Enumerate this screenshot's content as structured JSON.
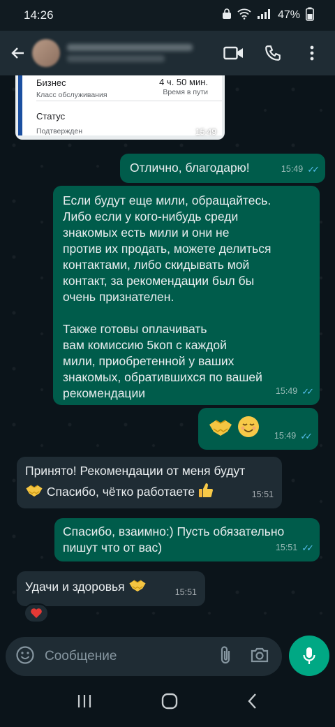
{
  "status_bar": {
    "time": "14:26",
    "battery": "47%"
  },
  "header": {
    "back_label": "←",
    "actions": [
      "video-call-icon",
      "phone-icon",
      "more-vert-icon"
    ]
  },
  "quoted_card": {
    "class_value": "Бизнес",
    "class_label": "Класс обслуживания",
    "duration_value": "4 ч. 50 мин.",
    "duration_label": "Время в пути",
    "status_value": "Статус",
    "status_label": "Подтвержден",
    "time": "15:49"
  },
  "messages": [
    {
      "id": "m1",
      "dir": "out",
      "text": "Отлично, благодарю!",
      "time": "15:49",
      "read": true
    },
    {
      "id": "m2",
      "dir": "out",
      "lines": [
        "Если будут еще мили, обращайтесь.",
        "Либо если у кого-нибудь среди",
        "знакомых есть мили и они не",
        "против их продать, можете делиться",
        "контактами, либо скидывать мой",
        "контакт, за рекомендации был бы",
        "очень признателен.",
        "",
        "Также готовы оплачивать",
        "вам комиссию 5коп с каждой",
        "мили, приобретенной у ваших",
        "знакомых, обратившихся по вашей",
        "рекомендации"
      ],
      "time": "15:49",
      "read": true
    },
    {
      "id": "m3",
      "dir": "out",
      "emojis": [
        "handshake",
        "relieved-face"
      ],
      "time": "15:49",
      "read": true
    },
    {
      "id": "m4",
      "dir": "in",
      "line1": "Принято! Рекомендации от меня будут",
      "line2": "Спасибо, чётко работаете",
      "time": "15:51"
    },
    {
      "id": "m5",
      "dir": "out",
      "lines": [
        "Спасибо, взаимно:) Пусть обязательно",
        "пишут что от вас)"
      ],
      "time": "15:51",
      "read": true
    },
    {
      "id": "m6",
      "dir": "in",
      "text": "Удачи и здоровья",
      "time": "15:51",
      "reaction": "red-heart"
    }
  ],
  "composer": {
    "placeholder": "Сообщение"
  },
  "colors": {
    "outgoing": "#005c4b",
    "incoming": "#1f2c34",
    "accent": "#00a884",
    "read_ticks": "#53bdeb"
  }
}
